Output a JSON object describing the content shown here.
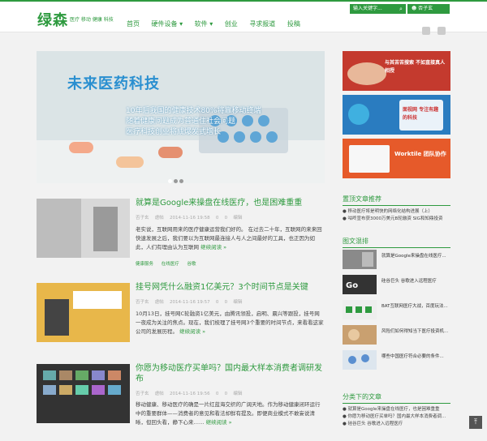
{
  "brand": {
    "logo_text": "绿森",
    "logo_sub": "医疗 移动 健康 科技"
  },
  "header": {
    "search_placeholder": "输入关键字...",
    "user_name": "否子玄"
  },
  "nav": {
    "items": [
      "首页",
      "硬件设备 ▾",
      "软件 ▾",
      "创业",
      "寻求报道",
      "投稿"
    ]
  },
  "hero": {
    "title": "未来医药科技",
    "lines": [
      "10年后我国的健康技术80%将靠移动终端",
      "随着健康问题成为普通住社会问题",
      "医疗科技创业将成爆发式增长"
    ],
    "slide_count": 3,
    "active_slide": 1
  },
  "ads": [
    {
      "text": "与其苦苦搜索 不如直接真人相授"
    },
    {
      "text": "面视网 专注有趣的科技"
    },
    {
      "text": "Worktile 团队协作"
    }
  ],
  "posts": [
    {
      "title": "就算是Google来操盘在线医疗，也是困难重重",
      "author": "否子玄",
      "category": "虐帖",
      "date": "2014-11-16 19:58",
      "views": "0",
      "comments": "0",
      "votes": "编辑",
      "excerpt": "老实说，互联网用来的医疗健康运营我们好的。 在过去二十年，互联网的来来回快速发展之后，我们要以为互联网最连接人与人之间最好的工具，也正因为如此，人们有理由认为互联网",
      "more": "继续阅读 »",
      "tags": [
        "健康服务",
        "在线医疗",
        "谷歌"
      ]
    },
    {
      "title": "挂号网凭什么融资1亿美元？3个时间节点是关键",
      "author": "否子玄",
      "category": "虐帖",
      "date": "2014-11-16 19:57",
      "views": "0",
      "comments": "0",
      "votes": "编辑",
      "excerpt": "10月13日，挂号网C轮融资1亿美元，由腾讯领投，启明、晨兴等跟投，挂号网一夜成为关注的焦点。现在，我们梳理了挂号网3个重要的时间节点，来看看这家公司的发展历程。",
      "more": "继续阅读 »",
      "tags": []
    },
    {
      "title": "你愿为移动医疗买单吗？国内最大样本消费者调研发布",
      "author": "否子玄",
      "category": "虐帖",
      "date": "2014-11-16 19:56",
      "views": "0",
      "comments": "0",
      "votes": "编辑",
      "excerpt": "移动健康、移动医疗的确是一片红蓝海交织的广阔天地。作为移动健康闭环运行中的重要群体——消费者的意见和看法却鲜有提及。即便商业模式不敢妄说清晰，但回头看，静下心来……",
      "more": "继续阅读 »",
      "tags": []
    }
  ],
  "sidebar": {
    "pinned_title": "置顶文章推荐",
    "pinned": [
      "● 移动医疗将是明快的网络化结构进展（上）",
      "● 咕咚宣布获3000万美元B轮融资 SIG和知鼎投资"
    ],
    "mixed_title": "图文混排",
    "mixed": [
      "就算是Google来操盘在线医疗...",
      "硅谷巨头 谷歌进入远程医疗",
      "BAT互联网医疗大战，百度玩法...",
      "风险们如何得知当下医疗投资机...",
      "哪些中国医疗符合必要的条件..."
    ],
    "category_title": "分类下的文章",
    "category_items": [
      "● 就算是Google来操盘在线医疗，也是困难重重",
      "● 你愿为移动医疗买单吗？国内最大样本消费者调...",
      "● 硅谷巨头 谷歌进入远程医疗"
    ]
  }
}
